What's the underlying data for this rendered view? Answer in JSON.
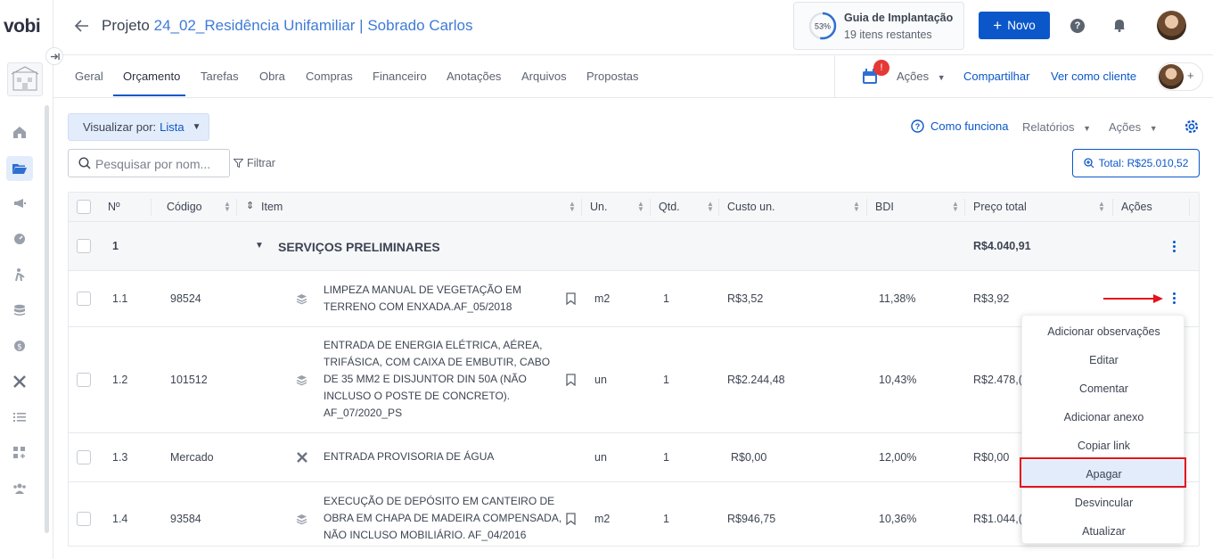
{
  "app": {
    "logo": "vobi"
  },
  "header": {
    "back_icon": "arrow-left-icon",
    "project_label": "Projeto",
    "project_name": "24_02_Residência Unifamiliar | Sobrado Carlos",
    "guide": {
      "percent": "53%",
      "progress": 0.53,
      "title": "Guia de Implantação",
      "subtitle": "19 itens restantes"
    },
    "new_button": "Novo",
    "help_icon": "question-circle-icon",
    "bell_icon": "bell-icon"
  },
  "sidebar": {
    "items": [
      {
        "icon": "home-icon",
        "active": false
      },
      {
        "icon": "folder-open-icon",
        "active": true
      },
      {
        "icon": "megaphone-icon",
        "active": false
      },
      {
        "icon": "gauge-icon",
        "active": false
      },
      {
        "icon": "worker-icon",
        "active": false
      },
      {
        "icon": "database-icon",
        "active": false
      },
      {
        "icon": "dollar-icon",
        "active": false
      },
      {
        "icon": "tools-icon",
        "active": false
      },
      {
        "icon": "list-icon",
        "active": false
      },
      {
        "icon": "grid-plus-icon",
        "active": false
      },
      {
        "icon": "users-icon",
        "active": false
      }
    ]
  },
  "tabs": {
    "items": [
      "Geral",
      "Orçamento",
      "Tarefas",
      "Obra",
      "Compras",
      "Financeiro",
      "Anotações",
      "Arquivos",
      "Propostas"
    ],
    "active": "Orçamento",
    "calendar_badge": "!",
    "actions": "Ações",
    "share": "Compartilhar",
    "view_as_client": "Ver como cliente",
    "avatar_add": "+"
  },
  "toolbar": {
    "view_by_label": "Visualizar por:",
    "view_by_value": "Lista",
    "how_it_works": "Como funciona",
    "reports": "Relatórios",
    "actions": "Ações",
    "search_placeholder": "Pesquisar por nom...",
    "filter": "Filtrar",
    "total": "Total: R$25.010,52"
  },
  "table": {
    "columns": [
      "Nº",
      "Código",
      "Item",
      "Un.",
      "Qtd.",
      "Custo un.",
      "BDI",
      "Preço total",
      "Ações"
    ],
    "group": {
      "number": "1",
      "title": "SERVIÇOS PRELIMINARES",
      "total": "R$4.040,91"
    },
    "rows": [
      {
        "n": "1.1",
        "code": "98524",
        "item": "LIMPEZA MANUAL DE VEGETAÇÃO EM TERRENO COM ENXADA.AF_05/2018",
        "un": "m2",
        "qty": "1",
        "cost": "R$3,52",
        "bdi": "11,38%",
        "total": "R$3,92"
      },
      {
        "n": "1.2",
        "code": "101512",
        "item": "ENTRADA DE ENERGIA ELÉTRICA, AÉREA, TRIFÁSICA, COM CAIXA DE EMBUTIR, CABO DE 35 MM2 E DISJUNTOR DIN 50A (NÃO INCLUSO O POSTE DE CONCRETO). AF_07/2020_PS",
        "un": "un",
        "qty": "1",
        "cost": "R$2.244,48",
        "bdi": "10,43%",
        "total": "R$2.478,("
      },
      {
        "n": "1.3",
        "code": "Mercado",
        "item": "ENTRADA PROVISORIA DE ÁGUA",
        "un": "un",
        "qty": "1",
        "cost": "R$0,00",
        "bdi": "12,00%",
        "total": "R$0,00"
      },
      {
        "n": "1.4",
        "code": "93584",
        "item": "EXECUÇÃO DE DEPÓSITO EM CANTEIRO DE OBRA EM CHAPA DE MADEIRA COMPENSADA, NÃO INCLUSO MOBILIÁRIO. AF_04/2016",
        "un": "m2",
        "qty": "1",
        "cost": "R$946,75",
        "bdi": "10,36%",
        "total": "R$1.044,("
      }
    ]
  },
  "context_menu": {
    "items": [
      "Adicionar observações",
      "Editar",
      "Comentar",
      "Adicionar anexo",
      "Copiar link",
      "Apagar",
      "Desvincular",
      "Atualizar"
    ],
    "highlighted": "Apagar"
  },
  "annotation": {
    "arrow_color": "#e3141b",
    "box_color": "#e3141b"
  },
  "colors": {
    "primary": "#0b57c9",
    "link": "#3e7bd6",
    "badge": "#e53935"
  }
}
